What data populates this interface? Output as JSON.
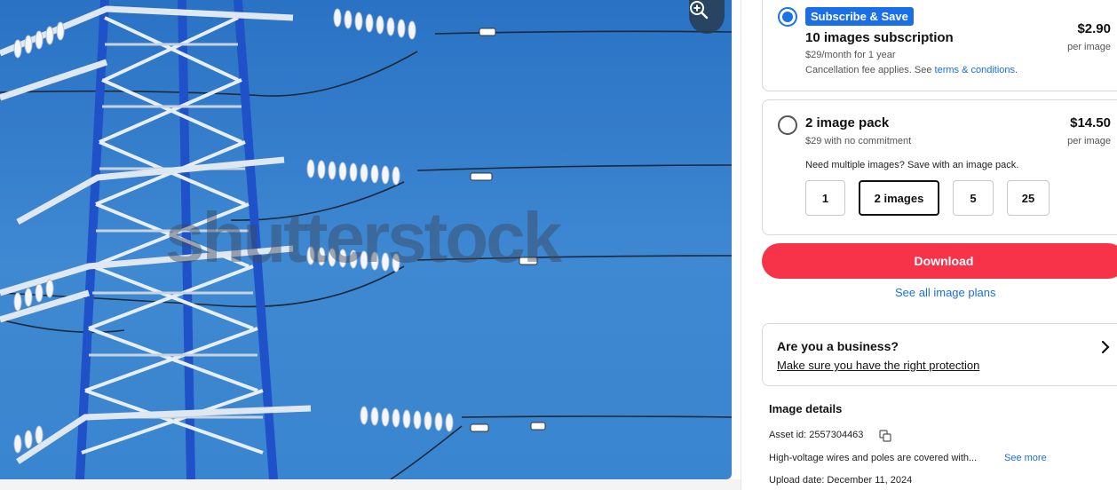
{
  "image": {
    "watermark": "shutterstock",
    "zoom_icon": "zoom-in-icon"
  },
  "subscription_option": {
    "selected": true,
    "badge": "Subscribe & Save",
    "title": "10 images subscription",
    "line1": "$29/month for 1 year",
    "line2_prefix": "Cancellation fee applies. See ",
    "line2_link": "terms & conditions.",
    "price": "$2.90",
    "per": "per image"
  },
  "pack_option": {
    "selected": false,
    "title": "2 image pack",
    "line1": "$29 with no commitment",
    "price": "$14.50",
    "per": "per image",
    "hint": "Need multiple images? Save with an image pack.",
    "quantities": [
      "1",
      "2 images",
      "5",
      "25"
    ],
    "selected_quantity": "2 images"
  },
  "actions": {
    "download_label": "Download",
    "see_plans_label": "See all image plans"
  },
  "business": {
    "title": "Are you a business?",
    "link": "Make sure you have the right protection",
    "icon": "chevron-right-icon"
  },
  "details": {
    "title": "Image details",
    "asset_id": "Asset id: 2557304463",
    "description": "High-voltage wires and poles are covered with...",
    "see_more": "See more",
    "upload_date": "Upload date: December 11, 2024"
  },
  "colors": {
    "accent_blue": "#1a6ee6",
    "download_red": "#f7334a",
    "sky": "#3a85cf",
    "tower_blue": "#1f52c9"
  }
}
